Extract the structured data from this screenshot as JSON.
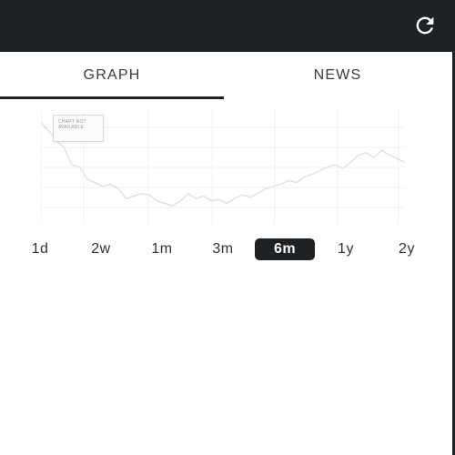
{
  "header": {
    "refresh_icon": "refresh-icon",
    "background": "#1f2224"
  },
  "tabs": [
    {
      "label": "GRAPH",
      "active": true
    },
    {
      "label": "NEWS",
      "active": false
    }
  ],
  "chart": {
    "notice": "CHART NOT AVAILABLE",
    "line_color": "#e2e2e2",
    "grid_color": "#f0f0f0",
    "series": [
      95,
      88,
      80,
      74,
      60,
      58,
      48,
      45,
      42,
      44,
      40,
      32,
      34,
      36,
      35,
      30,
      28,
      26,
      30,
      36,
      32,
      34,
      30,
      31,
      28,
      32,
      35,
      33,
      36,
      40,
      42,
      44,
      47,
      45,
      50,
      52,
      55,
      58,
      60,
      57,
      62,
      68,
      70,
      66,
      72,
      68,
      65,
      62
    ]
  },
  "ranges": [
    "1d",
    "2w",
    "1m",
    "3m",
    "6m",
    "1y",
    "2y"
  ],
  "active_range": "6m",
  "accent": "#1f2224"
}
